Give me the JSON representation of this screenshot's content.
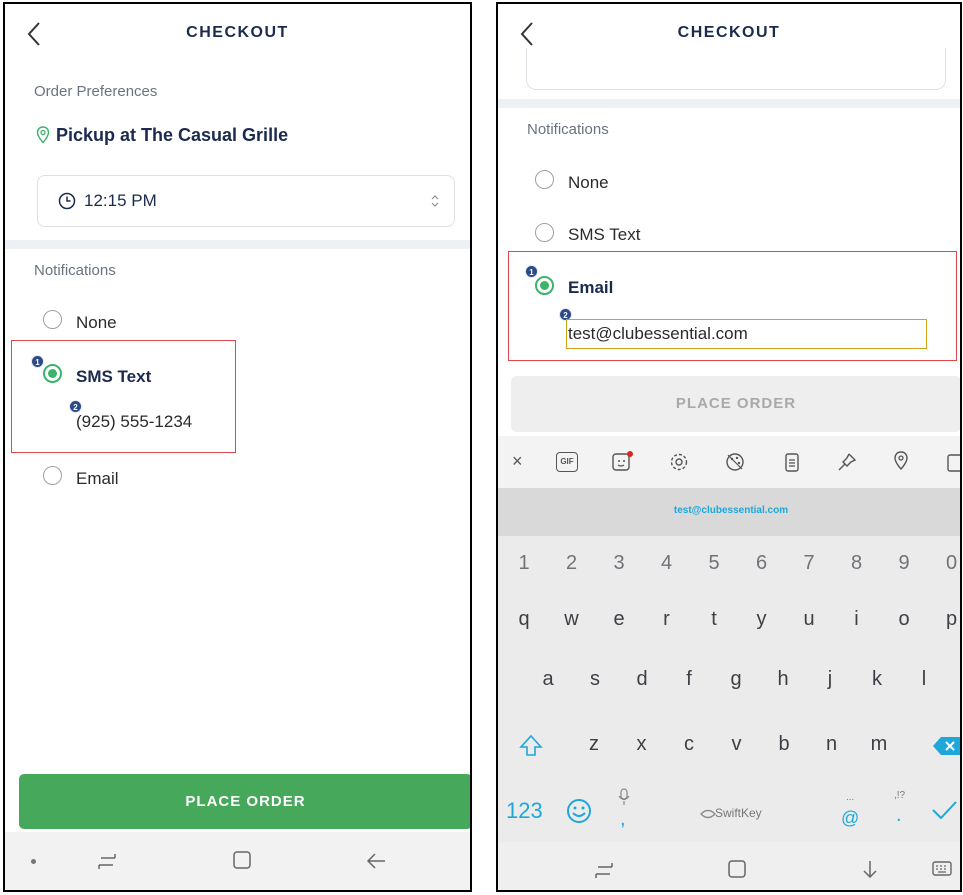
{
  "left": {
    "title": "CHECKOUT",
    "order_prefs_label": "Order Preferences",
    "pickup": "Pickup at The Casual Grille",
    "time": "12:15 PM",
    "notifications_label": "Notifications",
    "options": [
      "None",
      "SMS Text",
      "Email"
    ],
    "phone": "(925) 555-1234",
    "place_order": "PLACE ORDER",
    "badges": [
      "1",
      "2"
    ]
  },
  "right": {
    "title": "CHECKOUT",
    "notifications_label": "Notifications",
    "options": [
      "None",
      "SMS Text",
      "Email"
    ],
    "email_value": "test@clubessential.com",
    "place_order": "PLACE ORDER",
    "badges": [
      "1",
      "2"
    ],
    "suggestion": "test@clubessential.com",
    "kb_numbers": [
      "1",
      "2",
      "3",
      "4",
      "5",
      "6",
      "7",
      "8",
      "9",
      "0"
    ],
    "kb_row1": [
      "q",
      "w",
      "e",
      "r",
      "t",
      "y",
      "u",
      "i",
      "o",
      "p"
    ],
    "kb_row2": [
      "a",
      "s",
      "d",
      "f",
      "g",
      "h",
      "j",
      "k",
      "l"
    ],
    "kb_row3": [
      "z",
      "x",
      "c",
      "v",
      "b",
      "n",
      "m"
    ],
    "kb_123": "123",
    "kb_brand": "SwiftKey",
    "kb_at": "@",
    "kb_at_alt": "...",
    "kb_comma": ",",
    "kb_period": ".",
    "kb_period_alt": ",!?",
    "kb_gif": "GIF"
  },
  "colors": {
    "accent_green": "#45a85a",
    "radio_green": "#3bb36b",
    "highlight_red": "#e0474c",
    "badge_blue": "#2b4a86",
    "keyboard_blue": "#1ea7d8"
  }
}
